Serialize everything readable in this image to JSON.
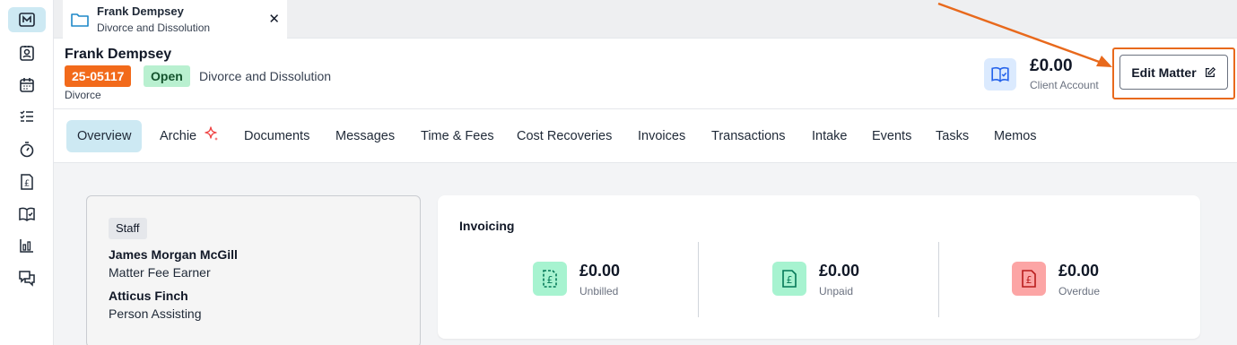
{
  "tab": {
    "title": "Frank Dempsey",
    "subtitle": "Divorce and Dissolution",
    "close": "✕"
  },
  "header": {
    "client_name": "Frank Dempsey",
    "matter_number": "25-05117",
    "status": "Open",
    "matter_type": "Divorce and Dissolution",
    "practice_area": "Divorce",
    "client_account_amount": "£0.00",
    "client_account_label": "Client Account",
    "edit_label": "Edit Matter"
  },
  "nav": {
    "items": [
      "Overview",
      "Archie",
      "Documents",
      "Messages",
      "Time & Fees",
      "Cost Recoveries",
      "Invoices",
      "Transactions",
      "Intake",
      "Events",
      "Tasks",
      "Memos"
    ]
  },
  "staff": {
    "heading": "Staff",
    "members": [
      {
        "name": "James Morgan McGill",
        "role": "Matter Fee Earner"
      },
      {
        "name": "Atticus Finch",
        "role": "Person Assisting"
      }
    ]
  },
  "invoicing": {
    "title": "Invoicing",
    "metrics": [
      {
        "amount": "£0.00",
        "label": "Unbilled",
        "color": "#a7f3d0"
      },
      {
        "amount": "£0.00",
        "label": "Unpaid",
        "color": "#a7f3d0"
      },
      {
        "amount": "£0.00",
        "label": "Overdue",
        "color": "#fca5a5"
      }
    ]
  },
  "colors": {
    "accent_orange": "#f26a1b",
    "open_green": "#b9f0d0",
    "active_tab": "#cde9f3",
    "annotation": "#e8691c"
  }
}
